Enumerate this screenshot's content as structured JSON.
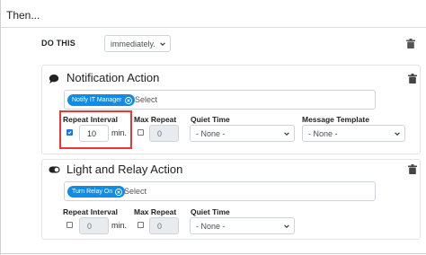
{
  "header": {
    "then_label": "Then..."
  },
  "do_this": {
    "label": "DO THIS",
    "value": "immediately."
  },
  "notification_action": {
    "title": "Notification Action",
    "tag": "Notify IT Manager",
    "tag_placeholder": "Select",
    "repeat_interval": {
      "label": "Repeat Interval",
      "checked": true,
      "value": "10",
      "unit": "min."
    },
    "max_repeat": {
      "label": "Max Repeat",
      "checked": false,
      "value": "0"
    },
    "quiet_time": {
      "label": "Quiet Time",
      "value": "- None -"
    },
    "message_template": {
      "label": "Message Template",
      "value": "- None -"
    }
  },
  "light_relay_action": {
    "title": "Light and Relay Action",
    "tag": "Turn Relay On",
    "tag_placeholder": "Select",
    "repeat_interval": {
      "label": "Repeat Interval",
      "checked": false,
      "value": "0",
      "unit": "min."
    },
    "max_repeat": {
      "label": "Max Repeat",
      "checked": false,
      "value": "0"
    },
    "quiet_time": {
      "label": "Quiet Time",
      "value": "- None -"
    }
  },
  "colors": {
    "accent": "#0d8ce9",
    "highlight": "#e53935"
  }
}
